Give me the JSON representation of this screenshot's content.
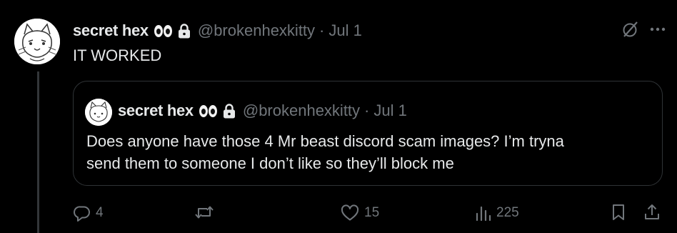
{
  "post": {
    "author_name": "secret hex",
    "handle": "@brokenhexkitty",
    "separator": "·",
    "date": "Jul 1",
    "text": "IT WORKED"
  },
  "quoted_post": {
    "author_name": "secret hex",
    "handle": "@brokenhexkitty",
    "separator": "·",
    "date": "Jul 1",
    "text_lines": [
      "Does anyone have those 4 Mr beast discord scam images? I’m tryna",
      "send them to someone I don’t like so they’ll block me"
    ]
  },
  "actions": {
    "replies": "4",
    "reposts": "",
    "likes": "15",
    "views": "225"
  },
  "icons": [
    "eyes-emoji",
    "lock-icon",
    "grok-icon",
    "more-icon",
    "reply-icon",
    "repost-icon",
    "like-icon",
    "views-icon",
    "bookmark-icon",
    "share-icon"
  ],
  "colors": {
    "background": "#000000",
    "text": "#e7e9ea",
    "muted": "#71767b",
    "border": "#2f3336"
  }
}
